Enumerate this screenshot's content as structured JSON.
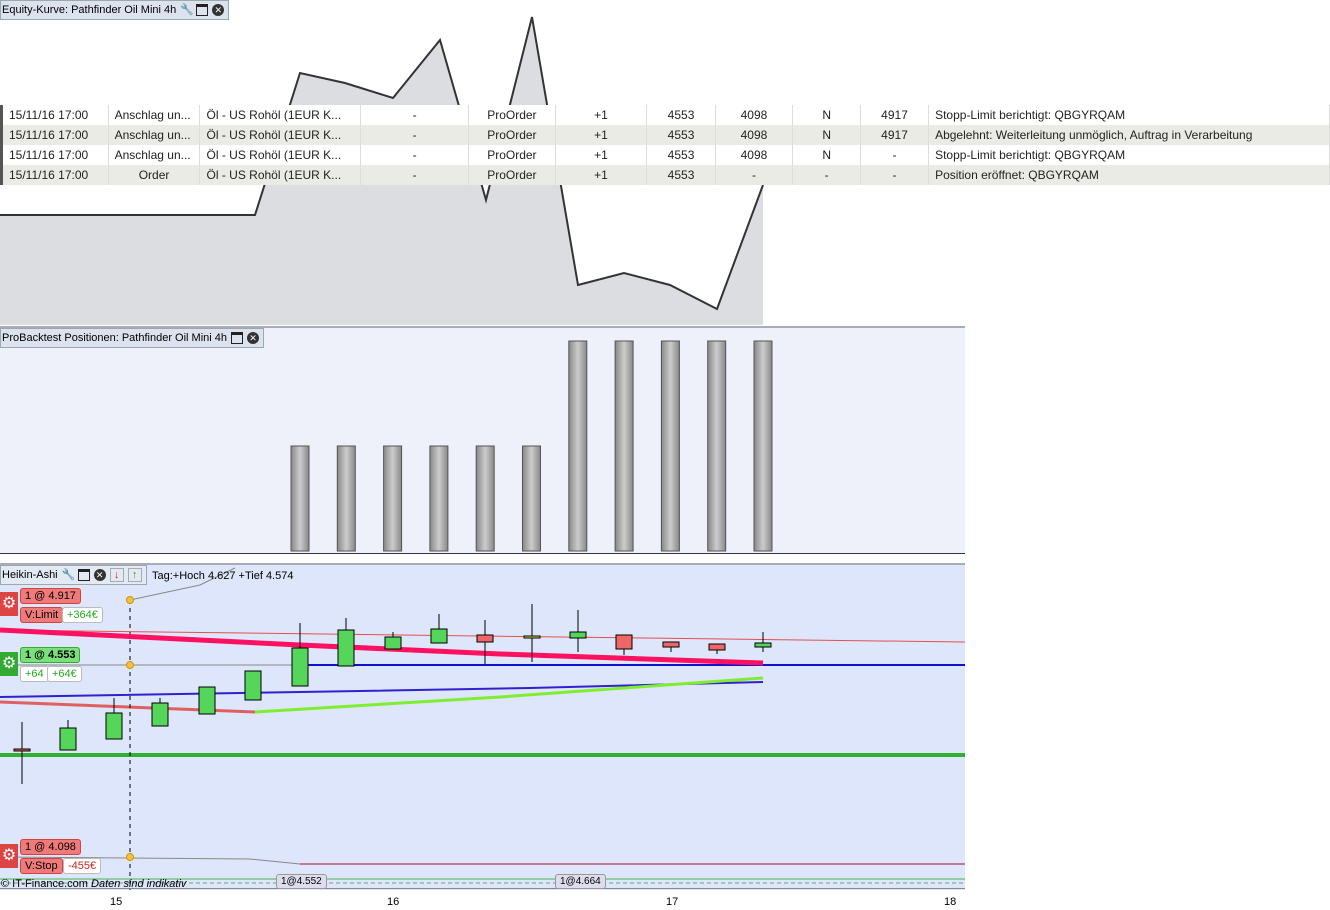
{
  "equity": {
    "title": "Equity-Kurve: Pathfinder Oil Mini 4h"
  },
  "orders": {
    "rows": [
      [
        "15/11/16 17:00",
        "Anschlag un...",
        "Öl - US Rohöl (1EUR K...",
        "-",
        "ProOrder",
        "+1",
        "4553",
        "4098",
        "N",
        "4917",
        "Stopp-Limit berichtigt: QBGYRQAM"
      ],
      [
        "15/11/16 17:00",
        "Anschlag un...",
        "Öl - US Rohöl (1EUR K...",
        "-",
        "ProOrder",
        "+1",
        "4553",
        "4098",
        "N",
        "4917",
        "Abgelehnt: Weiterleitung unmöglich, Auftrag in Verarbeitung"
      ],
      [
        "15/11/16 17:00",
        "Anschlag un...",
        "Öl - US Rohöl (1EUR K...",
        "-",
        "ProOrder",
        "+1",
        "4553",
        "4098",
        "N",
        "-",
        "Stopp-Limit berichtigt: QBGYRQAM"
      ],
      [
        "15/11/16 17:00",
        "Order",
        "Öl - US Rohöl (1EUR K...",
        "-",
        "ProOrder",
        "+1",
        "4553",
        "-",
        "-",
        "-",
        "Position eröffnet: QBGYRQAM"
      ]
    ]
  },
  "positions": {
    "title": "ProBacktest Positionen: Pathfinder Oil Mini 4h",
    "values": [
      0,
      0,
      0,
      0,
      0,
      0,
      1,
      1,
      1,
      1,
      1,
      1,
      2,
      2,
      2,
      2,
      2
    ]
  },
  "heikin": {
    "title": "Heikin-Ashi",
    "info": "Tag:+Hoch 4.627 +Tief 4.574",
    "limit": {
      "label": "1 @ 4.917",
      "type": "V:Limit",
      "pnl": "+364€"
    },
    "entry": {
      "label": "1 @ 4.553",
      "pts": "+64",
      "pnl": "+64€"
    },
    "stop": {
      "label": "1 @ 4.098",
      "type": "V:Stop",
      "pnl": "-455€"
    },
    "fill1": "1@4.552",
    "fill2": "1@4.664"
  },
  "footer": {
    "copyright": "© IT-Finance.com",
    "disclaimer": "Daten sind indikativ"
  },
  "axis": {
    "ticks": [
      "15",
      "16",
      "17",
      "18"
    ]
  },
  "colors": {
    "up": "#55d55a",
    "down": "#ee6666",
    "limit": "#f07070",
    "entry": "#70e070"
  }
}
